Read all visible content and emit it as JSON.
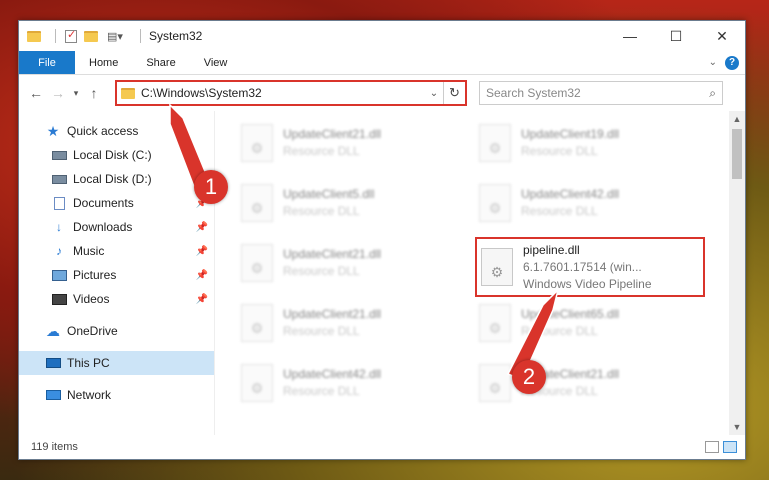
{
  "window": {
    "title": "System32",
    "controls": {
      "minimize": "—",
      "maximize": "☐",
      "close": "✕"
    }
  },
  "ribbon": {
    "tabs": [
      "File",
      "Home",
      "Share",
      "View"
    ]
  },
  "navbar": {
    "address": "C:\\Windows\\System32",
    "search_placeholder": "Search System32"
  },
  "sidebar": {
    "quick_access": "Quick access",
    "items": [
      {
        "label": "Local Disk (C:)",
        "icon": "drive-icon",
        "pinned": false
      },
      {
        "label": "Local Disk (D:)",
        "icon": "drive-icon",
        "pinned": false
      },
      {
        "label": "Documents",
        "icon": "documents-icon",
        "pinned": true
      },
      {
        "label": "Downloads",
        "icon": "downloads-icon",
        "pinned": true
      },
      {
        "label": "Music",
        "icon": "music-icon",
        "pinned": true
      },
      {
        "label": "Pictures",
        "icon": "pictures-icon",
        "pinned": true
      },
      {
        "label": "Videos",
        "icon": "videos-icon",
        "pinned": true
      }
    ],
    "onedrive": "OneDrive",
    "this_pc": "This PC",
    "network": "Network"
  },
  "files": [
    {
      "name": "UpdateClient21.dll",
      "sub": "Resource DLL",
      "sub2": ""
    },
    {
      "name": "UpdateClient19.dll",
      "sub": "Resource DLL",
      "sub2": ""
    },
    {
      "name": "UpdateClient5.dll",
      "sub": "Resource DLL",
      "sub2": ""
    },
    {
      "name": "UpdateClient42.dll",
      "sub": "Resource DLL",
      "sub2": ""
    },
    {
      "name": "UpdateClient21.dll",
      "sub": "Resource DLL",
      "sub2": ""
    },
    {
      "name": "pipeline.dll",
      "sub": "6.1.7601.17514 (win...",
      "sub2": "Windows Video Pipeline"
    },
    {
      "name": "UpdateClient21.dll",
      "sub": "Resource DLL",
      "sub2": ""
    },
    {
      "name": "UpdateClient65.dll",
      "sub": "Resource DLL",
      "sub2": ""
    },
    {
      "name": "UpdateClient42.dll",
      "sub": "Resource DLL",
      "sub2": ""
    },
    {
      "name": "UpdateClient21.dll",
      "sub": "Resource DLL",
      "sub2": ""
    }
  ],
  "status": {
    "items": "119 items"
  },
  "markers": [
    "1",
    "2"
  ],
  "colors": {
    "accent": "#1979ca",
    "highlight": "#d9342b"
  }
}
